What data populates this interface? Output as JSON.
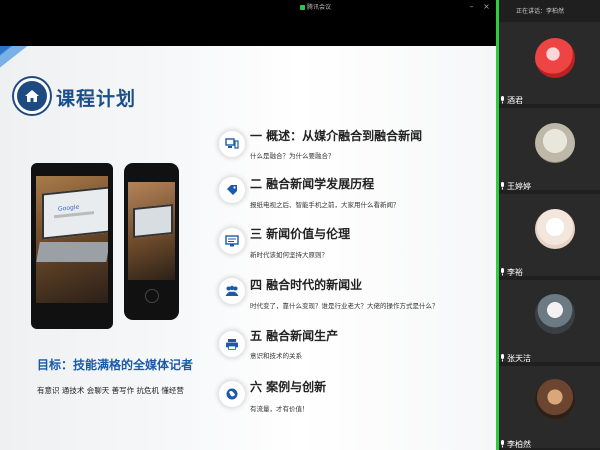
{
  "topbar": {
    "app_title": "腾讯会议"
  },
  "slide": {
    "title": "课程计划",
    "goal_title": "目标：技能满格的全媒体记者",
    "goal_subtitle": "有意识 通技术 会聊天 善写作 抗危机 懂经营",
    "items": [
      {
        "title": "一  概述：从媒介融合到融合新闻",
        "subtitle": "什么是融合？为什么要融合？",
        "icon": "devices-icon"
      },
      {
        "title": "二  融合新闻学发展历程",
        "subtitle": "报纸电视之后、智能手机之前，大家用什么看新闻？",
        "icon": "tag-icon"
      },
      {
        "title": "三  新闻价值与伦理",
        "subtitle": "新时代该如何坚持大原则？",
        "icon": "document-icon"
      },
      {
        "title": "四  融合时代的新闻业",
        "subtitle": "时代变了，靠什么变现？谁是行业老大？大佬的操作方式是什么？",
        "icon": "people-icon"
      },
      {
        "title": "五  融合新闻生产",
        "subtitle": "意识和技术的关系",
        "icon": "printer-icon"
      },
      {
        "title": "六  案例与创新",
        "subtitle": "有流量，才有价值！",
        "icon": "globe-icon"
      }
    ]
  },
  "participants": {
    "header": "正在讲话：李柏然",
    "list": [
      {
        "name": "酒君"
      },
      {
        "name": "王婷婷"
      },
      {
        "name": "李裕"
      },
      {
        "name": "张天洁"
      },
      {
        "name": "李柏然"
      }
    ]
  },
  "colors": {
    "accent_blue": "#1b5aa8",
    "active_speaker": "#2ecc40",
    "panel_bg": "#1f1f1f"
  }
}
